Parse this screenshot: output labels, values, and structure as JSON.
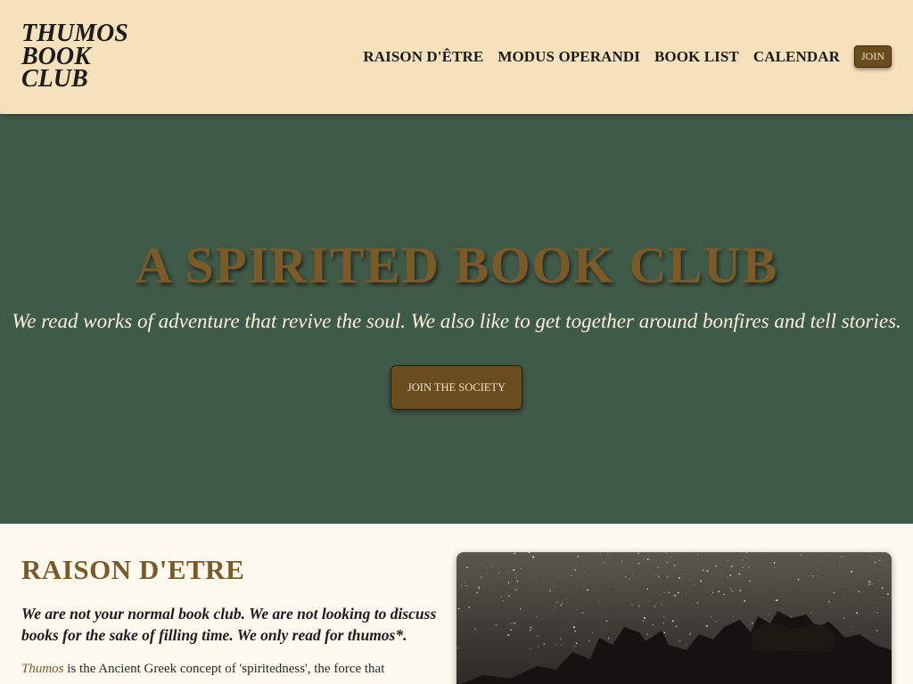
{
  "header": {
    "logo_lines": [
      "THUMOS",
      "BOOK",
      "CLUB"
    ],
    "nav": [
      {
        "label": "RAISON D'ÊTRE"
      },
      {
        "label": "MODUS OPERANDI"
      },
      {
        "label": "BOOK LIST"
      },
      {
        "label": "CALENDAR"
      }
    ],
    "join_label": "JOIN"
  },
  "hero": {
    "title": "A SPIRITED BOOK CLUB",
    "subtitle": "We read works of adventure that revive the soul. We also like to get together around bonfires and tell stories.",
    "cta_label": "JOIN THE SOCIETY"
  },
  "raison": {
    "title": "RAISON D'ETRE",
    "lead": "We are not your normal book club. We are not looking to discuss books for the sake of filling time. We only read for thumos*.",
    "body_term": "Thumos",
    "body_rest": " is the Ancient Greek concept of 'spiritedness', the force that"
  },
  "colors": {
    "header_bg": "#f5e2bc",
    "hero_bg": "#405a48",
    "accent_brown": "#6a4d1e",
    "title_brown": "#7a5a28"
  }
}
